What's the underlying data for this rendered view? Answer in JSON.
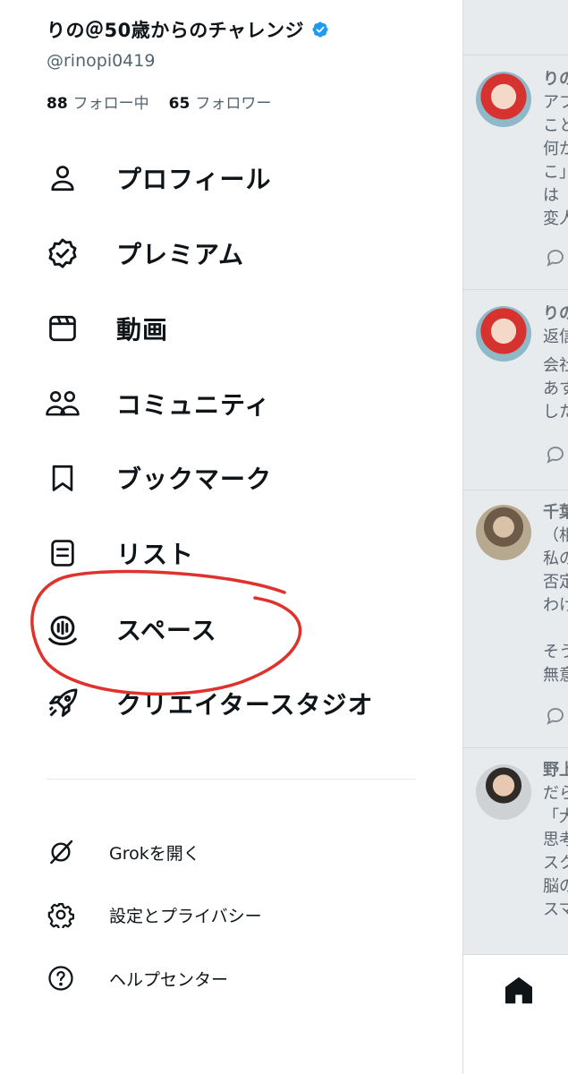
{
  "profile": {
    "name": "りの＠50歳からのチャレンジ",
    "handle": "@rinopi0419",
    "following_count": "88",
    "following_label": "フォロー中",
    "followers_count": "65",
    "followers_label": "フォロワー"
  },
  "menu": [
    {
      "label": "プロフィール",
      "icon": "person-icon"
    },
    {
      "label": "プレミアム",
      "icon": "verified-badge-icon"
    },
    {
      "label": "動画",
      "icon": "video-icon"
    },
    {
      "label": "コミュニティ",
      "icon": "communities-icon"
    },
    {
      "label": "ブックマーク",
      "icon": "bookmark-icon"
    },
    {
      "label": "リスト",
      "icon": "list-icon"
    },
    {
      "label": "スペース",
      "icon": "spaces-icon"
    },
    {
      "label": "クリエイタースタジオ",
      "icon": "rocket-icon"
    }
  ],
  "secondary": [
    {
      "label": "Grokを開く",
      "icon": "grok-icon"
    },
    {
      "label": "設定とプライバシー",
      "icon": "gear-icon"
    },
    {
      "label": "ヘルプセンター",
      "icon": "help-icon"
    }
  ],
  "timeline": {
    "tweets": [
      {
        "lines": [
          "りの",
          "アプ",
          "こと",
          "何か",
          "こ」",
          "は「",
          "変人"
        ]
      },
      {
        "lines": [
          "りの",
          "返信",
          "会社",
          "あす",
          "した"
        ]
      },
      {
        "lines": [
          "千葉",
          "（相",
          "私の",
          "否定",
          "わけ",
          "",
          "そう",
          "無意"
        ]
      },
      {
        "lines": [
          "野上",
          "だら",
          "「大",
          "思考",
          "スク",
          "脳の",
          "スマ"
        ]
      }
    ]
  },
  "colors": {
    "text": "#0f1419",
    "secondary_text": "#536471",
    "verified_blue": "#1d9bf0",
    "annotation_red": "#e0322c",
    "timeline_dim": "#e8ebee"
  }
}
